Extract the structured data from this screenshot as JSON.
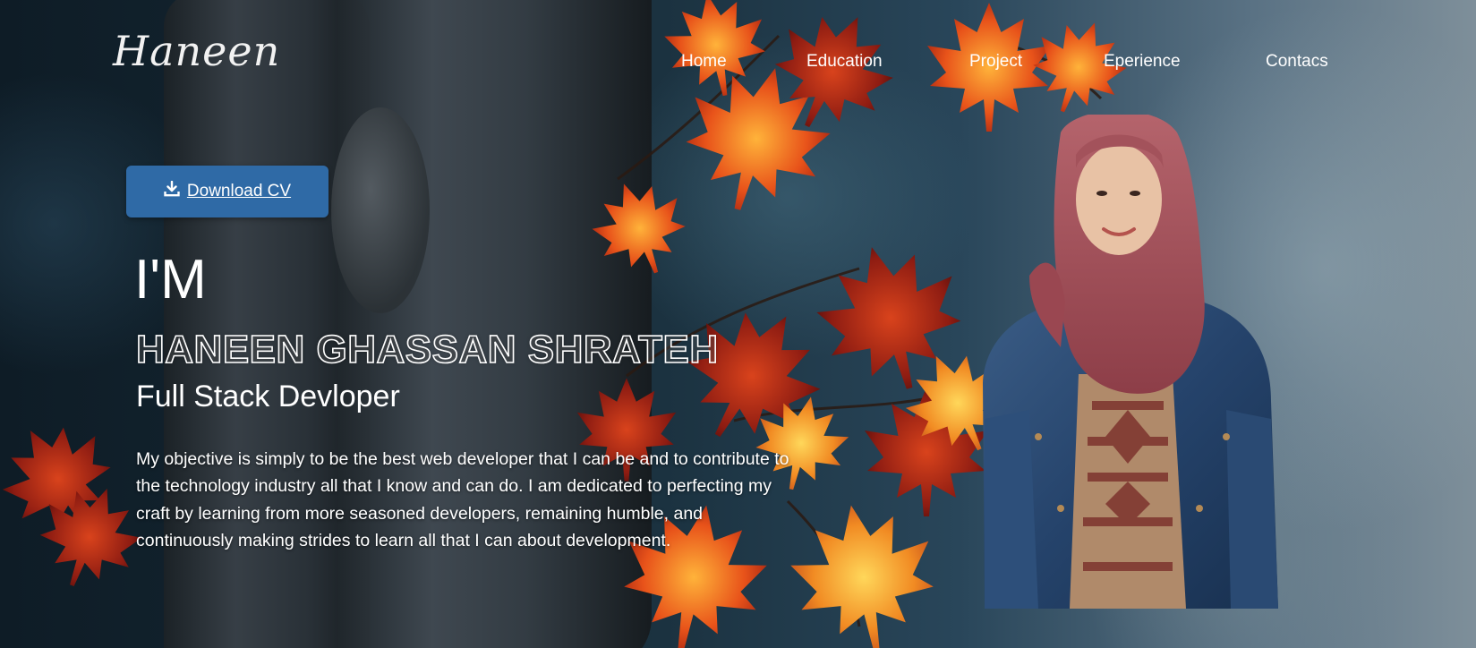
{
  "logo": {
    "text": "Haneen"
  },
  "nav": {
    "items": [
      {
        "label": "Home"
      },
      {
        "label": "Education"
      },
      {
        "label": "Project"
      },
      {
        "label": "Eperience"
      },
      {
        "label": "Contacs"
      }
    ]
  },
  "hero": {
    "download_button": {
      "label": "Download CV",
      "icon": "download-icon"
    },
    "greeting": "I'M",
    "name": "HANEEN GHASSAN SHRATEH",
    "role": "Full Stack Devloper",
    "objective": "My objective is simply to be the best web developer that I can be and to contribute to the technology industry all that I know and can do. I am dedicated to perfecting my craft by learning from more seasoned developers, remaining humble, and continuously making strides to learn all that I can about development.",
    "portrait_icon": "profile-photo",
    "accent_color": "#2f6aa6"
  }
}
